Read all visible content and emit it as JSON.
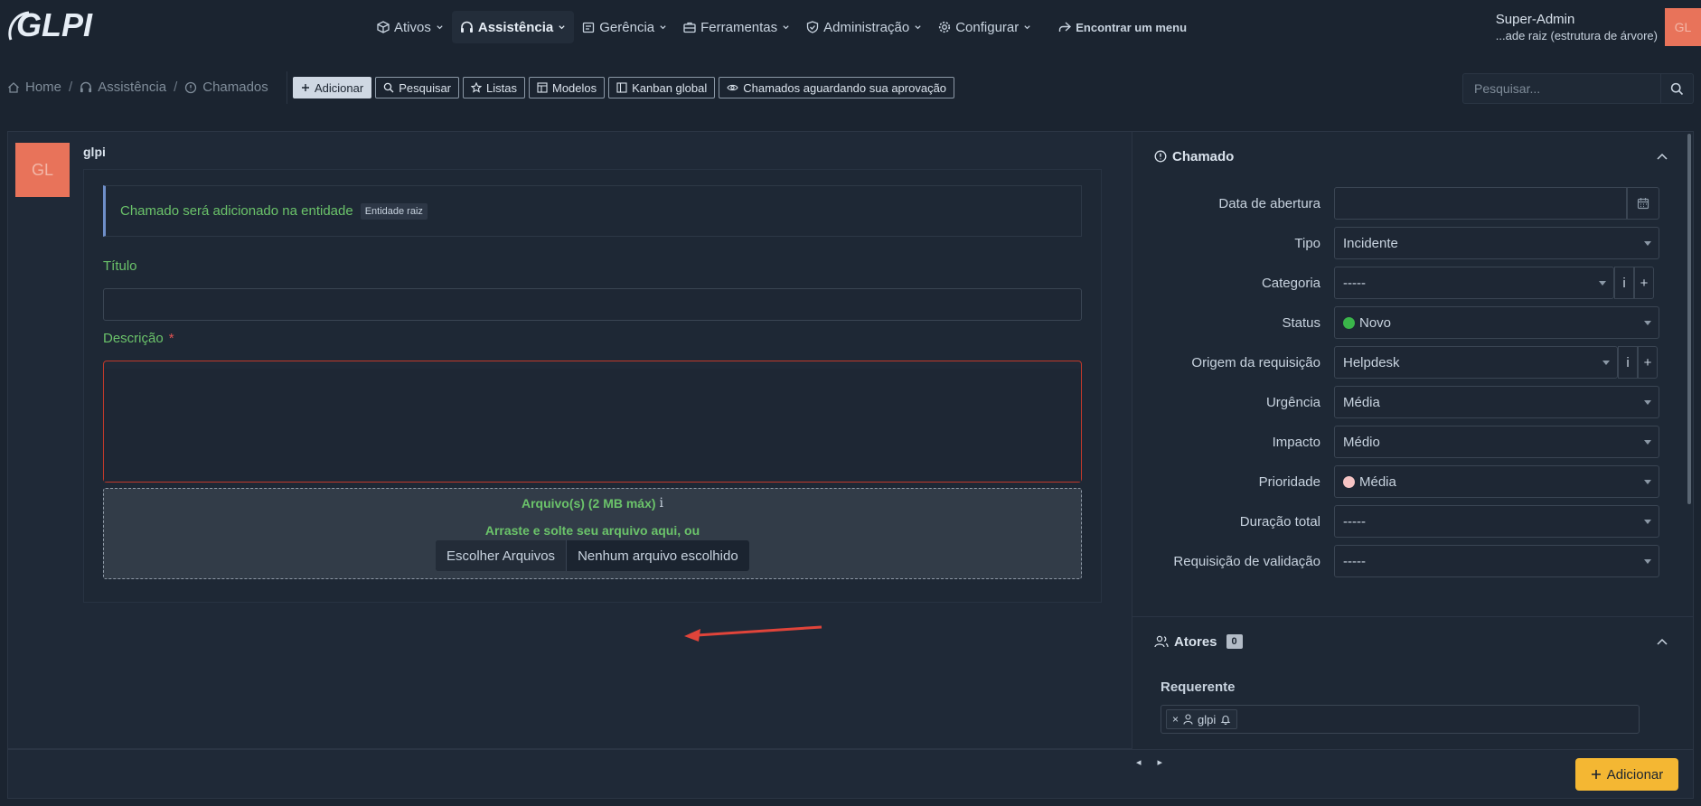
{
  "app": {
    "logo_text": "GLPI"
  },
  "nav": {
    "items": [
      {
        "label": "Ativos",
        "icon": "box-icon"
      },
      {
        "label": "Assistência",
        "icon": "headset-icon"
      },
      {
        "label": "Gerência",
        "icon": "wallet-icon"
      },
      {
        "label": "Ferramentas",
        "icon": "briefcase-icon"
      },
      {
        "label": "Administração",
        "icon": "shield-icon"
      },
      {
        "label": "Configurar",
        "icon": "gear-icon"
      }
    ],
    "find_menu": "Encontrar um menu",
    "active_index": 1
  },
  "user": {
    "name": "Super-Admin",
    "entity": "...ade raiz (estrutura de árvore)",
    "initials": "GL"
  },
  "breadcrumb": {
    "home": "Home",
    "assist": "Assistência",
    "tickets": "Chamados",
    "separator": "/"
  },
  "actions": {
    "add": "Adicionar",
    "search": "Pesquisar",
    "lists": "Listas",
    "models": "Modelos",
    "kanban": "Kanban global",
    "approval": "Chamados aguardando sua aprovação"
  },
  "search": {
    "placeholder": "Pesquisar..."
  },
  "form": {
    "author_initials": "GL",
    "author_name": "glpi",
    "alert_text": "Chamado será adicionado na entidade",
    "entity_badge": "Entidade raiz",
    "title_label": "Título",
    "title_value": "",
    "description_label": "Descrição",
    "required_mark": "*",
    "files_label": "Arquivo(s) (2 MB máx)",
    "files_info": "i",
    "drop_text": "Arraste e solte seu arquivo aqui, ou",
    "choose_files": "Escolher Arquivos",
    "no_file": "Nenhum arquivo escolhido"
  },
  "panel": {
    "ticket_title": "Chamado",
    "fields": {
      "opening_date": {
        "label": "Data de abertura",
        "value": ""
      },
      "type": {
        "label": "Tipo",
        "value": "Incidente"
      },
      "category": {
        "label": "Categoria",
        "value": "-----"
      },
      "status": {
        "label": "Status",
        "value": "Novo",
        "color": "#3ab54a"
      },
      "origin": {
        "label": "Origem da requisição",
        "value": "Helpdesk"
      },
      "urgency": {
        "label": "Urgência",
        "value": "Média"
      },
      "impact": {
        "label": "Impacto",
        "value": "Médio"
      },
      "priority": {
        "label": "Prioridade",
        "value": "Média",
        "color": "#f6c4c4"
      },
      "duration": {
        "label": "Duração total",
        "value": "-----"
      },
      "validation": {
        "label": "Requisição de validação",
        "value": "-----"
      }
    },
    "info_glyph": "i",
    "plus_glyph": "+",
    "actors_title": "Atores",
    "actors_count": "0",
    "requester_label": "Requerente",
    "requester_chip": "glpi",
    "chip_remove": "×"
  },
  "footer": {
    "prev": "◂",
    "next": "▸",
    "add_button": "Adicionar"
  },
  "colors": {
    "accent": "#f4b733",
    "success_text": "#6bc36a",
    "danger": "#e05252",
    "avatar": "#e8735a"
  }
}
